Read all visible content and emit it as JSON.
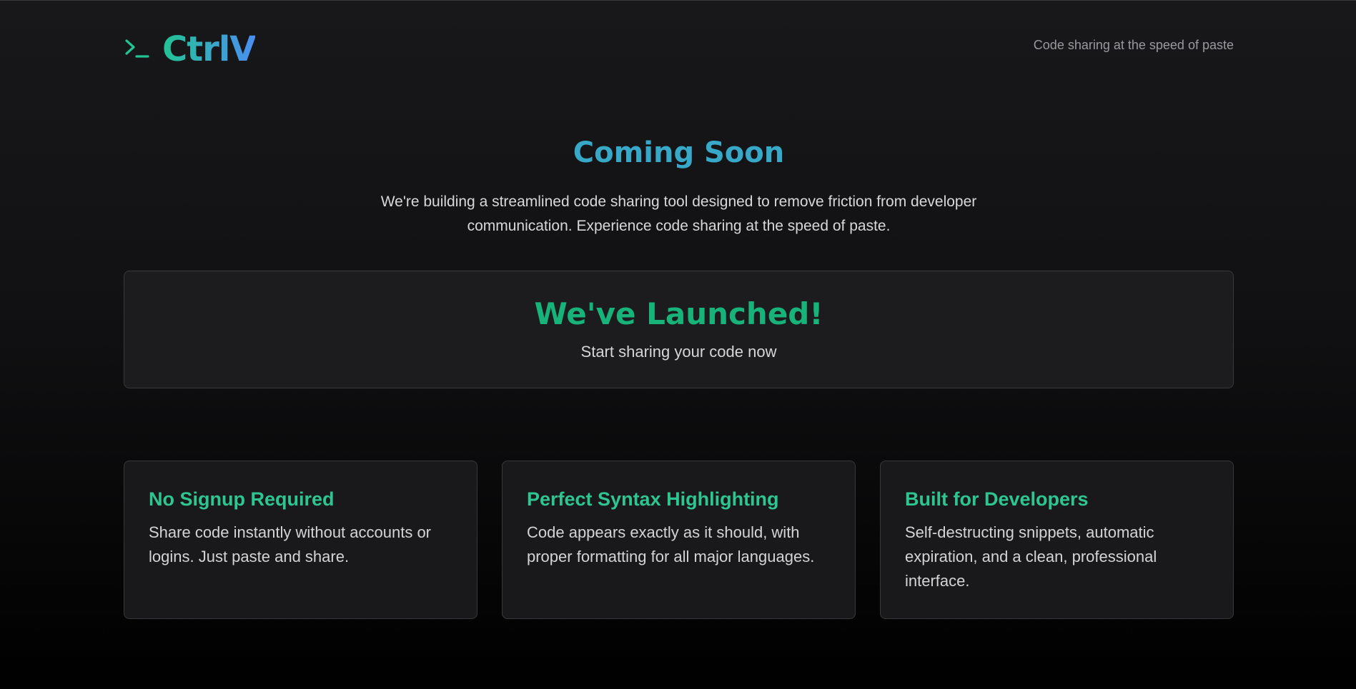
{
  "header": {
    "logo_text": "CtrlV",
    "logo_icon": "terminal-prompt-icon",
    "tagline": "Code sharing at the speed of paste"
  },
  "hero": {
    "title": "Coming Soon",
    "description": "We're building a streamlined code sharing tool designed to remove friction from developer communication. Experience code sharing at the speed of paste."
  },
  "launch": {
    "title": "We've Launched!",
    "subtitle": "Start sharing your code now"
  },
  "features": [
    {
      "title": "No Signup Required",
      "text": "Share code instantly without accounts or logins. Just paste and share."
    },
    {
      "title": "Perfect Syntax Highlighting",
      "text": "Code appears exactly as it should, with proper formatting for all major languages."
    },
    {
      "title": "Built for Developers",
      "text": "Self-destructing snippets, automatic expiration, and a clean, professional interface."
    }
  ],
  "colors": {
    "brand_green": "#22c493",
    "brand_blue": "#4a8ef2",
    "heading_teal": "#38a8c9",
    "launch_green": "#17b37a",
    "card_title_green": "#2ec690"
  }
}
